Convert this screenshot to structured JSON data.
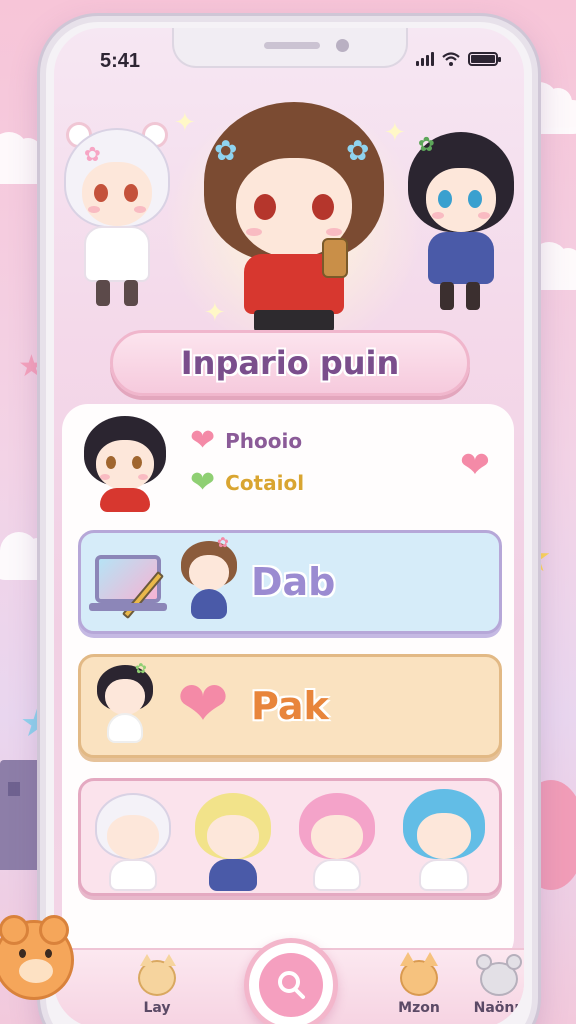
{
  "status_bar": {
    "time": "5:41"
  },
  "title": "Inpario puin",
  "profile": {
    "stat1_label": "Phooio",
    "stat2_label": "Cotaiol"
  },
  "menu": {
    "dab_label": "Dab",
    "pak_label": "Pak"
  },
  "tabbar": {
    "lay_label": "Lay",
    "mon_label": "Mzon",
    "nav_label": "Naönp"
  },
  "icons": {
    "heart": "heart-icon",
    "search": "search-icon",
    "laptop": "laptop-icon"
  },
  "colors": {
    "accent_pink": "#f48aa7",
    "title_purple": "#7a4e8c",
    "dab_blue": "#d6ecf9",
    "pak_orange": "#fae2c0"
  }
}
